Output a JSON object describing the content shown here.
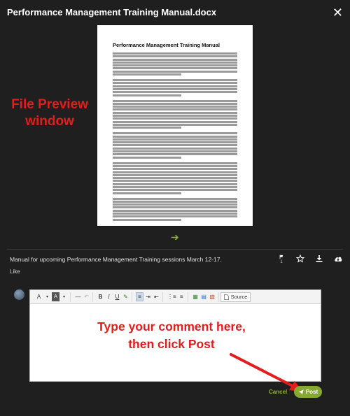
{
  "header": {
    "title": "Performance Management Training Manual.docx",
    "close_icon": "close-icon"
  },
  "preview": {
    "doc_title": "Performance Management Training Manual",
    "paragraph_lines": [
      8,
      6,
      10,
      9,
      11,
      8
    ],
    "next_icon": "arrow-right-icon"
  },
  "annotations": {
    "file_preview": "File Preview window",
    "type_comment_line1": "Type your comment here,",
    "type_comment_line2": "then click Post",
    "color": "#e31c1c"
  },
  "item": {
    "description": "Manual for upcoming Performance Management Training sessions March 12-17.",
    "like_label": "Like",
    "flag_count": "1",
    "actions": [
      "flag-icon",
      "star-icon",
      "download-icon",
      "cloud-upload-icon"
    ]
  },
  "editor": {
    "source_label": "Source",
    "toolbar_groups": [
      [
        "A",
        "A"
      ],
      [
        "—",
        "↶"
      ],
      [
        "B",
        "I",
        "U",
        "✎"
      ],
      [
        "≡",
        "⇥",
        "⇤"
      ],
      [
        "⋮≡",
        "≡"
      ],
      [
        "▦",
        "▤",
        "▧"
      ]
    ],
    "comment_value": ""
  },
  "buttons": {
    "cancel_label": "Cancel",
    "post_label": "Post"
  },
  "colors": {
    "accent": "#87a931",
    "background": "#1f1f1f"
  }
}
